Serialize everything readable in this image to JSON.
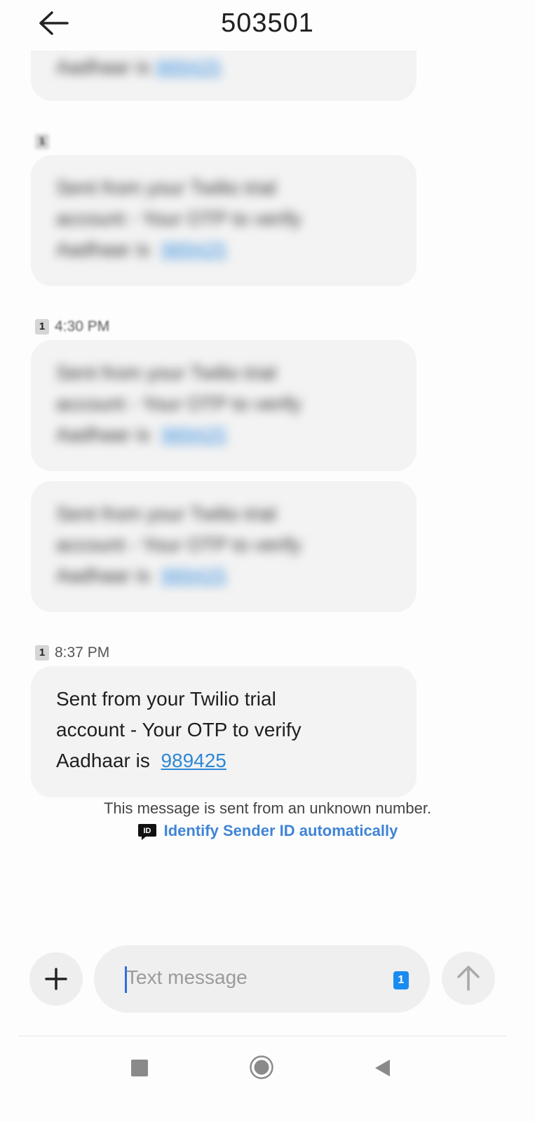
{
  "header": {
    "title": "503501",
    "back_icon": "arrow-left-icon"
  },
  "messages": [
    {
      "meta": {
        "sim": "",
        "time": ""
      },
      "lines": [
        "Aadhaar is"
      ],
      "link": "989425",
      "blurred": true
    },
    {
      "meta": {
        "sim": "1",
        "time": ""
      },
      "lines": [
        "Sent from your Twilio trial",
        "account - Your OTP to verify",
        "Aadhaar is"
      ],
      "link": "989425",
      "blurred": true
    },
    {
      "meta": {
        "sim": "1",
        "time": "4:30 PM"
      },
      "lines": [
        "Sent from your Twilio trial",
        "account - Your OTP to verify",
        "Aadhaar is"
      ],
      "link": "989425",
      "blurred": true
    },
    {
      "meta": {
        "sim": "",
        "time": ""
      },
      "lines": [
        "Sent from your Twilio trial",
        "account - Your OTP to verify",
        "Aadhaar is"
      ],
      "link": "989425",
      "blurred": true
    },
    {
      "meta": {
        "sim": "1",
        "time": "8:37 PM"
      },
      "lines": [
        "Sent from your Twilio trial",
        "account - Your OTP to verify",
        "Aadhaar is"
      ],
      "link": "989425",
      "blurred": false
    }
  ],
  "notice": {
    "text": "This message is sent from an unknown number.",
    "identify_label": "Identify Sender ID automatically",
    "identify_icon": "id-badge-icon",
    "identify_icon_text": "ID"
  },
  "compose": {
    "placeholder": "Text message",
    "sim": "1",
    "plus_icon": "plus-icon",
    "send_icon": "send-arrow-up-icon"
  },
  "nav": {
    "recents": "square-recents-icon",
    "home": "circle-home-icon",
    "back": "triangle-back-icon"
  },
  "colors": {
    "link": "#2d88d6",
    "identify": "#3f84d6",
    "sim_accent": "#1a8cf0",
    "bubble": "#f3f3f3"
  }
}
